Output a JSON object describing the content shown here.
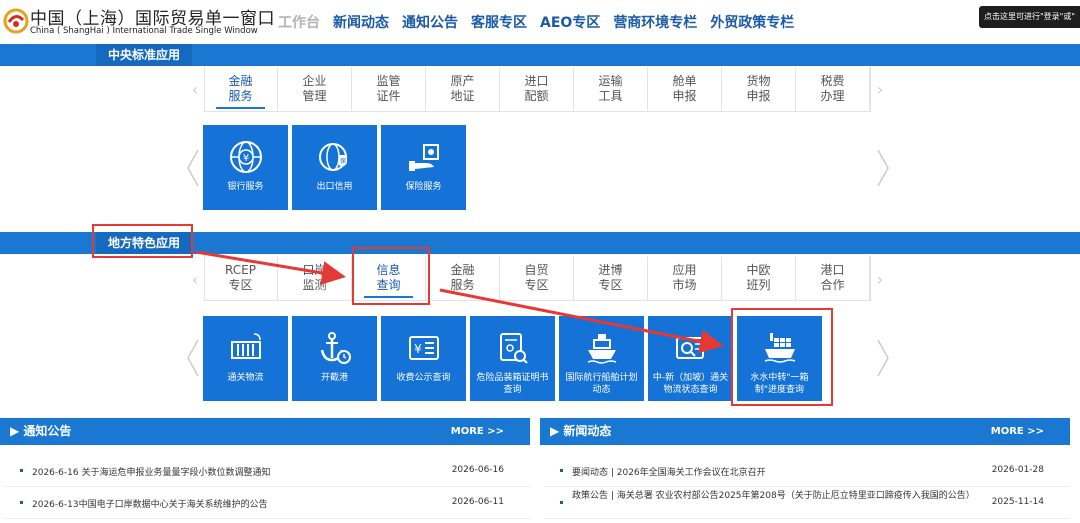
{
  "header": {
    "logo_cn": "中国（上海）国际贸易单一窗口",
    "logo_en": "China ( ShangHai ) International Trade Single Window",
    "nav": [
      "工作台",
      "新闻动态",
      "通知公告",
      "客服专区",
      "AEO专区",
      "营商环境专栏",
      "外贸政策专栏"
    ],
    "tooltip": "点击这里可进行\"登录\"或\""
  },
  "central": {
    "label": "中央标准应用",
    "tabs": [
      {
        "l1": "金融",
        "l2": "服务"
      },
      {
        "l1": "企业",
        "l2": "管理"
      },
      {
        "l1": "监管",
        "l2": "证件"
      },
      {
        "l1": "原产",
        "l2": "地证"
      },
      {
        "l1": "进口",
        "l2": "配额"
      },
      {
        "l1": "运输",
        "l2": "工具"
      },
      {
        "l1": "舱单",
        "l2": "申报"
      },
      {
        "l1": "货物",
        "l2": "申报"
      },
      {
        "l1": "税费",
        "l2": "办理"
      }
    ],
    "tiles": [
      "银行服务",
      "出口信用",
      "保险服务"
    ]
  },
  "local": {
    "label": "地方特色应用",
    "tabs": [
      {
        "l1": "RCEP",
        "l2": "专区"
      },
      {
        "l1": "口岸",
        "l2": "监测"
      },
      {
        "l1": "信息",
        "l2": "查询"
      },
      {
        "l1": "金融",
        "l2": "服务"
      },
      {
        "l1": "自贸",
        "l2": "专区"
      },
      {
        "l1": "进博",
        "l2": "专区"
      },
      {
        "l1": "应用",
        "l2": "市场"
      },
      {
        "l1": "中欧",
        "l2": "班列"
      },
      {
        "l1": "港口",
        "l2": "合作"
      }
    ],
    "tiles": [
      "通关物流",
      "开截港",
      "收费公示查询",
      "危险品装箱证明书查询",
      "国际航行船舶计划动态",
      "中-新（加坡）通关物流状态查询",
      "水水中转\"一箱制\"进度查询"
    ]
  },
  "notices": {
    "title": "通知公告",
    "more": "MORE >>",
    "rows": [
      {
        "title": "2026-6-16 关于海运危申报业务量量字段小数位数调整通知",
        "date": "2026-06-16"
      },
      {
        "title": "2026-6-13中国电子口岸数据中心关于海关系统维护的公告",
        "date": "2026-06-11"
      }
    ]
  },
  "news": {
    "title": "新闻动态",
    "more": "MORE >>",
    "rows": [
      {
        "title": "要闻动态 | 2026年全国海关工作会议在北京召开",
        "date": "2026-01-28"
      },
      {
        "title": "政策公告 | 海关总署 农业农村部公告2025年第208号（关于防止厄立特里亚口蹄疫传入我国的公告）",
        "date": "2025-11-14"
      }
    ]
  },
  "colors": {
    "brand_blue": "#1a78d2",
    "tile_blue": "#1572d6",
    "callout_red": "#e53935"
  }
}
